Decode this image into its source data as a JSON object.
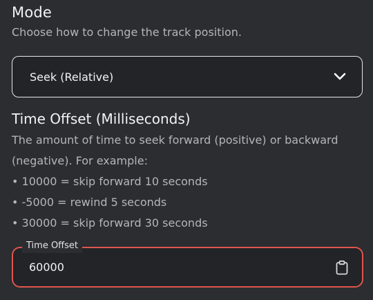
{
  "mode": {
    "heading": "Mode",
    "help": "Choose how to change the track position.",
    "selected": "Seek (Relative)",
    "expand_icon": "chevron-down-icon"
  },
  "time_offset": {
    "heading": "Time Offset (Milliseconds)",
    "description_lines": [
      "The amount of time to seek forward (positive) or backward",
      "(negative). For example:",
      "• 10000 = skip forward 10 seconds",
      "• -5000 = rewind 5 seconds",
      "• 30000 = skip forward 30 seconds"
    ],
    "field_label": "Time Offset",
    "field_value": "60000",
    "field_icon": "clipboard-icon"
  },
  "colors": {
    "background": "#2b2d31",
    "input_background": "#232428",
    "select_border": "#e6e7ea",
    "error_border": "#e0554d"
  }
}
